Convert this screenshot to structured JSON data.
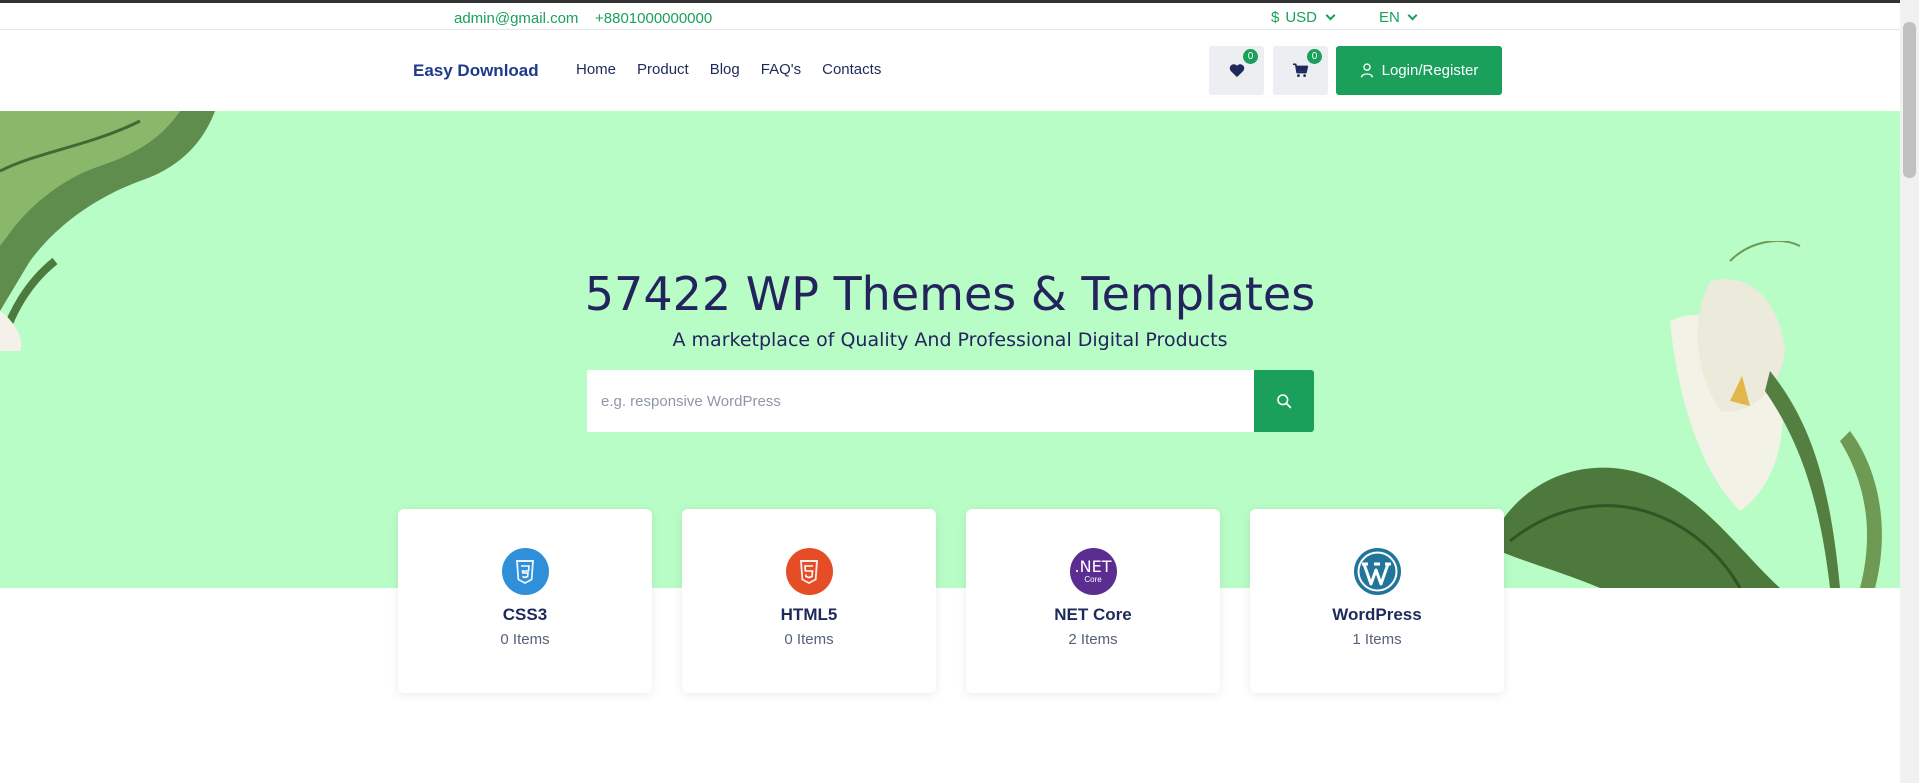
{
  "topbar": {
    "email": "admin@gmail.com",
    "phone": "+8801000000000",
    "currency_symbol": "$",
    "currency": "USD",
    "language": "EN"
  },
  "header": {
    "logo": "Easy Download",
    "nav": [
      "Home",
      "Product",
      "Blog",
      "FAQ's",
      "Contacts"
    ],
    "wishlist_count": "0",
    "cart_count": "0",
    "login_label": "Login/Register"
  },
  "hero": {
    "title": "57422 WP Themes & Templates",
    "subtitle": "A marketplace of Quality And Professional Digital Products",
    "search_placeholder": "e.g. responsive WordPress"
  },
  "categories": [
    {
      "name": "CSS3",
      "count": "0 Items",
      "icon": "css3-icon",
      "color": "#2f8fd8"
    },
    {
      "name": "HTML5",
      "count": "0 Items",
      "icon": "html5-icon",
      "color": "#e54d26"
    },
    {
      "name": "NET Core",
      "count": "2 Items",
      "icon": "dotnet-core-icon",
      "color": "#5c2d91",
      "icon_text": ".NET",
      "icon_subtext": "Core"
    },
    {
      "name": "WordPress",
      "count": "1 Items",
      "icon": "wordpress-icon",
      "color": "#21759b"
    }
  ],
  "colors": {
    "accent": "#1aa05b",
    "hero_bg": "#b8fcc6",
    "heading": "#23245e"
  }
}
